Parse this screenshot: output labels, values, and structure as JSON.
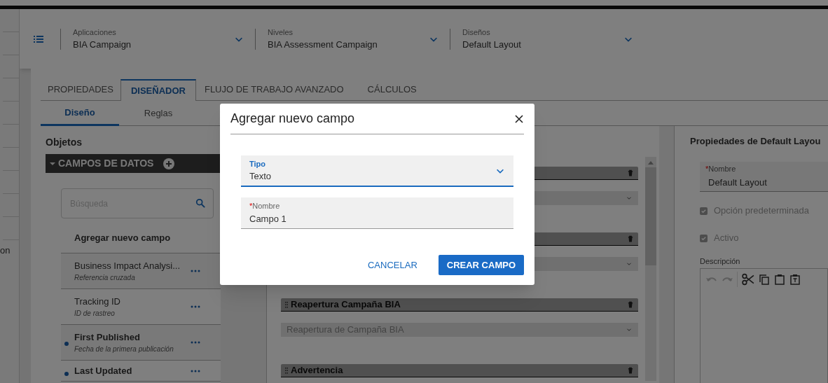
{
  "left_nav": {
    "items": [
      "on"
    ]
  },
  "header": {
    "selectors": [
      {
        "label": "Aplicaciones",
        "value": "BIA Campaign"
      },
      {
        "label": "Niveles",
        "value": "BIA Assessment Campaign"
      },
      {
        "label": "Diseños",
        "value": "Default Layout"
      }
    ]
  },
  "tabs": [
    {
      "label": "PROPIEDADES",
      "selected": false
    },
    {
      "label": "DISEÑADOR",
      "selected": true
    },
    {
      "label": "FLUJO DE TRABAJO AVANZADO",
      "selected": false
    },
    {
      "label": "CÁLCULOS",
      "selected": false
    }
  ],
  "subtabs": [
    {
      "label": "Diseño",
      "selected": true
    },
    {
      "label": "Reglas",
      "selected": false
    }
  ],
  "objects_panel": {
    "title": "Objetos",
    "section": {
      "title": "CAMPOS DE DATOS",
      "expanded": true
    },
    "search": {
      "placeholder": "Búsqueda"
    },
    "add_link": "Agregar nuevo campo",
    "fields": [
      {
        "name": "Business Impact Analysi...",
        "type": "Referencia cruzada",
        "modified": false
      },
      {
        "name": "Tracking ID",
        "type": "ID de rastreo",
        "modified": false
      },
      {
        "name": "First Published",
        "type": "Fecha de la primera publicación",
        "modified": true
      },
      {
        "name": "Last Updated",
        "modified": true
      }
    ]
  },
  "designer_items": [
    {
      "kind": "header"
    },
    {
      "kind": "select"
    },
    {
      "kind": "header"
    },
    {
      "kind": "select"
    },
    {
      "kind": "header",
      "title": "Reapertura Campaña BIA"
    },
    {
      "kind": "select",
      "value": "Reapertura de Campaña BIA"
    },
    {
      "kind": "header",
      "title": "Advertencia"
    }
  ],
  "properties_panel": {
    "title": "Propiedades de Default Layou",
    "name_field": {
      "label": "Nombre",
      "required_mark": "*",
      "value": "Default Layout"
    },
    "options": [
      {
        "label": "Opción predeterminada",
        "checked": true
      },
      {
        "label": "Activo",
        "checked": true
      }
    ],
    "description_label": "Descripción"
  },
  "dialog": {
    "title": "Agregar nuevo campo",
    "fields": [
      {
        "kind": "select",
        "label": "Tipo",
        "value": "Texto",
        "focused": true
      },
      {
        "kind": "text",
        "label": "Nombre",
        "required_mark": "*",
        "value": "Campo 1",
        "focused": false
      }
    ],
    "buttons": [
      {
        "label": "CANCELAR",
        "primary": false
      },
      {
        "label": "CREAR CAMPO",
        "primary": true
      }
    ]
  }
}
